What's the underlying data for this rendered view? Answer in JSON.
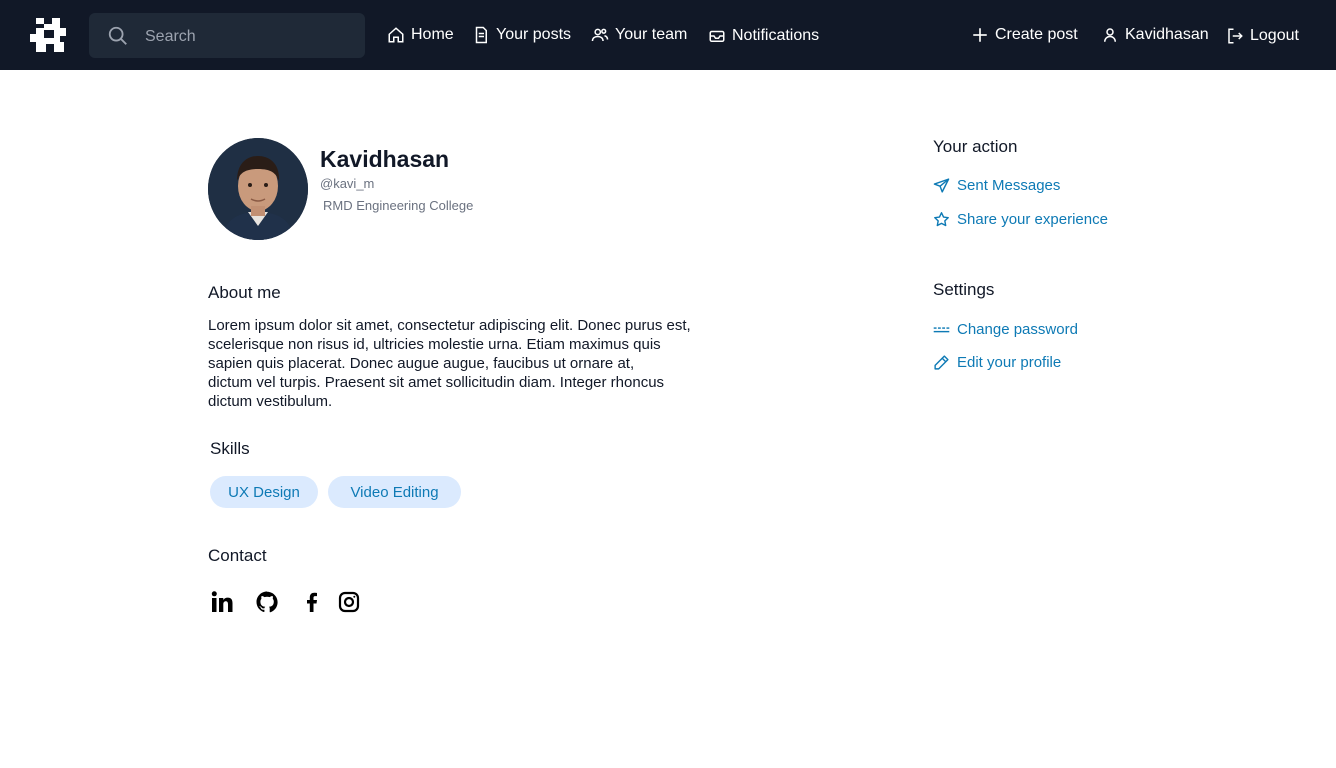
{
  "nav": {
    "search_placeholder": "Search",
    "items": [
      {
        "label": "Home",
        "icon": "home-icon"
      },
      {
        "label": "Your posts",
        "icon": "document-icon"
      },
      {
        "label": "Your team",
        "icon": "users-icon"
      },
      {
        "label": "Notifications",
        "icon": "inbox-icon"
      }
    ],
    "right": [
      {
        "label": "Create post",
        "icon": "plus-icon"
      },
      {
        "label": "Kavidhasan",
        "icon": "user-icon"
      },
      {
        "label": "Logout",
        "icon": "logout-icon"
      }
    ]
  },
  "profile": {
    "name": "Kavidhasan",
    "handle": "@kavi_m",
    "college": "RMD Engineering College"
  },
  "about": {
    "title": "About me",
    "lines": [
      "Lorem ipsum dolor sit amet, consectetur adipiscing elit. Donec purus est,",
      "scelerisque non risus id, ultricies  molestie urna. Etiam maximus quis",
      "sapien quis placerat. Donec augue augue, faucibus ut ornare at,",
      "dictum vel turpis. Praesent sit amet sollicitudin diam. Integer rhoncus",
      "dictum vestibulum."
    ]
  },
  "skills": {
    "title": "Skills",
    "items": [
      "UX Design",
      "Video Editing"
    ]
  },
  "contact": {
    "title": "Contact",
    "icons": [
      "linkedin-icon",
      "github-icon",
      "facebook-icon",
      "instagram-icon"
    ]
  },
  "actions": {
    "title": "Your action",
    "items": [
      {
        "label": "Sent Messages",
        "icon": "send-icon"
      },
      {
        "label": "Share your experience",
        "icon": "star-icon"
      }
    ]
  },
  "settings": {
    "title": "Settings",
    "items": [
      {
        "label": "Change password",
        "icon": "password-icon"
      },
      {
        "label": "Edit your profile",
        "icon": "pencil-icon"
      }
    ]
  },
  "colors": {
    "nav_bg": "#111827",
    "accent": "#0e7ab5",
    "chip_bg": "#dbeafe"
  }
}
